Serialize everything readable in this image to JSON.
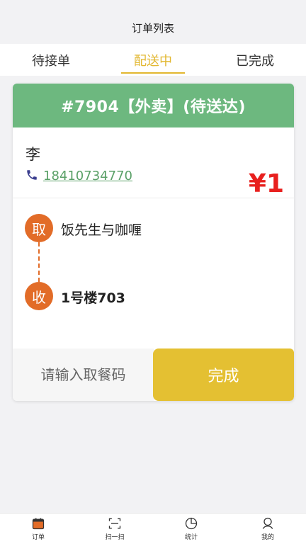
{
  "header": {
    "title": "订单列表"
  },
  "tabs": [
    {
      "label": "待接单",
      "active": false
    },
    {
      "label": "配送中",
      "active": true
    },
    {
      "label": "已完成",
      "active": false
    }
  ],
  "order": {
    "heading": "#7904【外卖】(待送达)",
    "customer_name": "李",
    "phone": "18410734770",
    "price": "¥1",
    "pickup_badge": "取",
    "pickup_name": "饭先生与咖喱",
    "receive_badge": "收",
    "receive_address": "1号楼703",
    "code_placeholder": "请输入取餐码",
    "complete_label": "完成"
  },
  "bottom_nav": [
    {
      "label": "订单",
      "icon": "calendar-icon"
    },
    {
      "label": "扫一扫",
      "icon": "scan-icon"
    },
    {
      "label": "统计",
      "icon": "pie-chart-icon"
    },
    {
      "label": "我的",
      "icon": "user-icon"
    }
  ],
  "colors": {
    "accent": "#e2b730",
    "card_header": "#6db87f",
    "badge": "#e26c28",
    "price": "#e8201e",
    "complete_button": "#e4c032"
  }
}
